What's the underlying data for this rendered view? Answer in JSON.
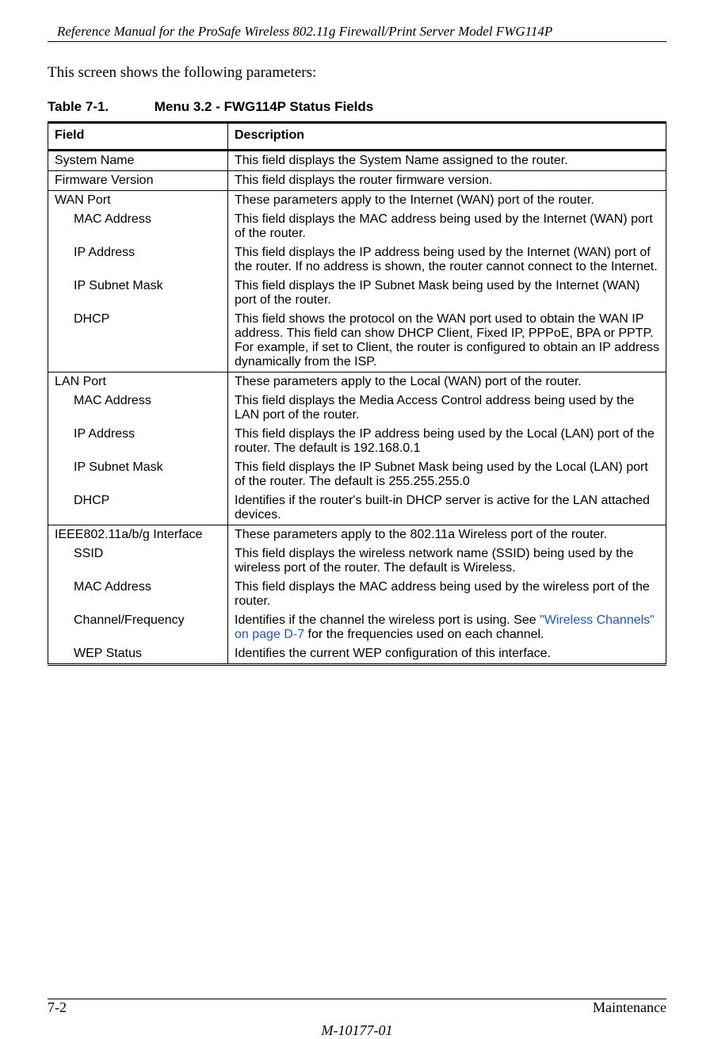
{
  "running_header": "Reference Manual for the ProSafe Wireless 802.11g  Firewall/Print Server Model FWG114P",
  "intro": "This screen shows the following parameters:",
  "table_caption_number": "Table 7-1.",
  "table_caption_title": "Menu 3.2 - FWG114P Status Fields",
  "headers": {
    "field": "Field",
    "description": "Description"
  },
  "rows": {
    "r1": {
      "field": "System Name",
      "desc": "This field displays the System Name assigned to the router."
    },
    "r2": {
      "field": "Firmware Version",
      "desc": "This field displays the router firmware version."
    },
    "r3": {
      "field": "WAN Port",
      "desc": "These parameters apply to the Internet (WAN) port of the router."
    },
    "r4": {
      "field": "MAC Address",
      "desc": "This field displays the MAC address being used by the Internet (WAN) port of the router."
    },
    "r5": {
      "field": "IP Address",
      "desc": "This field displays the IP address being used by the Internet (WAN) port of the router. If no address is shown, the router cannot connect to the Internet."
    },
    "r6": {
      "field": "IP Subnet Mask",
      "desc": "This field displays the IP Subnet Mask being used by the Internet (WAN) port of the router."
    },
    "r7": {
      "field": "DHCP",
      "desc": "This field shows the protocol on the WAN port used to obtain the WAN IP address. This field can show DHCP Client, Fixed IP, PPPoE, BPA or PPTP. For example, if set to Client, the router is configured to obtain an IP address dynamically from the ISP."
    },
    "r8": {
      "field": "LAN Port",
      "desc": "These parameters apply to the Local (WAN) port of the router."
    },
    "r9": {
      "field": "MAC Address",
      "desc": "This field displays the Media Access Control address being used by the LAN port of the router."
    },
    "r10": {
      "field": "IP Address",
      "desc": "This field displays the IP address being used by the Local (LAN) port of the router. The default is 192.168.0.1"
    },
    "r11": {
      "field": "IP Subnet Mask",
      "desc": "This field displays the IP Subnet Mask being used by the Local (LAN) port of the router. The default is 255.255.255.0"
    },
    "r12": {
      "field": "DHCP",
      "desc": "Identifies if the router's built-in DHCP server is active for the LAN attached devices."
    },
    "r13": {
      "field": "IEEE802.11a/b/g Interface",
      "desc": "These parameters apply to the 802.11a Wireless port of the router."
    },
    "r14": {
      "field": "SSID",
      "desc": "This field displays the wireless network name (SSID) being used by the wireless port of the router. The default is Wireless."
    },
    "r15": {
      "field": "MAC Address",
      "desc": "This field displays the MAC address being used by the wireless port of the router."
    },
    "r16": {
      "field": "Channel/Frequency",
      "desc_pre": "Identifies if the channel the wireless port is using. See ",
      "desc_link": "\"Wireless Channels\" on page D-7",
      "desc_post": " for the frequencies used on each channel."
    },
    "r17": {
      "field": "WEP Status",
      "desc": "Identifies the current WEP configuration of this interface."
    }
  },
  "footer": {
    "page": "7-2",
    "section": "Maintenance",
    "docnum": "M-10177-01"
  }
}
